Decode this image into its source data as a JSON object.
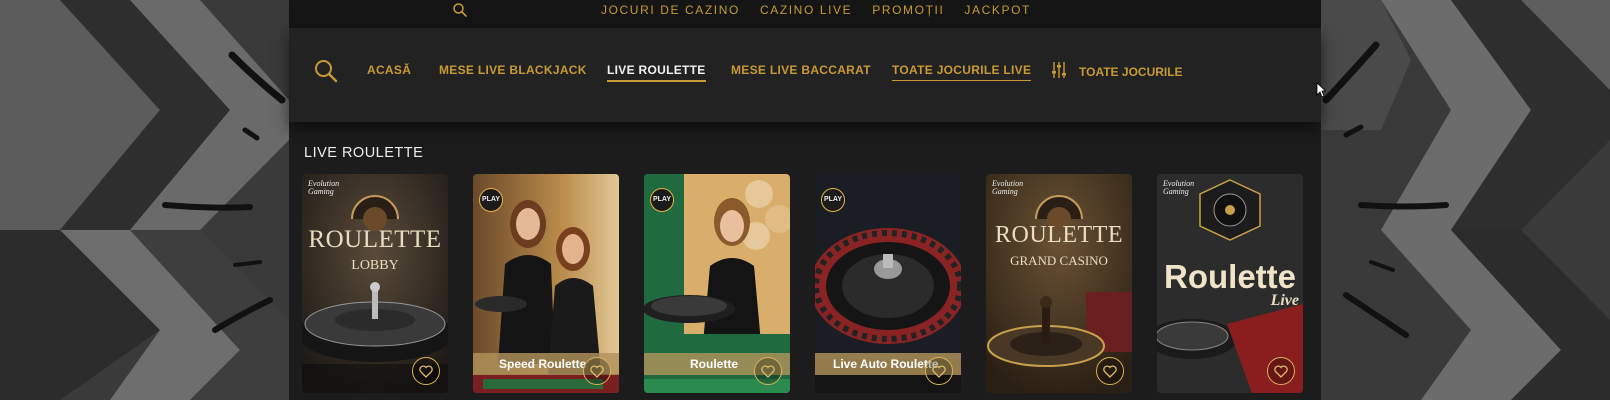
{
  "top_nav": {
    "links": [
      "JOCURI DE CAZINO",
      "CAZINO LIVE",
      "PROMOȚII",
      "JACKPOT"
    ]
  },
  "category_nav": {
    "tabs": [
      {
        "label": "ACASĂ",
        "state": "normal"
      },
      {
        "label": "MESE LIVE BLACKJACK",
        "state": "normal"
      },
      {
        "label": "LIVE ROULETTE",
        "state": "active"
      },
      {
        "label": "MESE LIVE BACCARAT",
        "state": "normal"
      },
      {
        "label": "TOATE JOCURILE LIVE",
        "state": "hover"
      }
    ],
    "filter_label": "TOATE JOCURILE"
  },
  "section": {
    "title": "LIVE ROULETTE"
  },
  "games": [
    {
      "provider": "Evolution Gaming",
      "art_title": "ROULETTE",
      "art_subtitle": "LOBBY",
      "name": "",
      "icon": "heart-icon"
    },
    {
      "provider": "PLAY",
      "art_title": "",
      "art_subtitle": "",
      "name": "Speed Roulette",
      "icon": "heart-icon"
    },
    {
      "provider": "PLAY",
      "art_title": "",
      "art_subtitle": "",
      "name": "Roulette",
      "icon": "heart-icon"
    },
    {
      "provider": "PLAY",
      "art_title": "",
      "art_subtitle": "",
      "name": "Live Auto Roulette",
      "icon": "heart-icon"
    },
    {
      "provider": "Evolution Gaming",
      "art_title": "ROULETTE",
      "art_subtitle": "GRAND CASINO",
      "name": "",
      "icon": "heart-icon"
    },
    {
      "provider": "Evolution Gaming",
      "art_title": "Roulette",
      "art_subtitle": "Live",
      "name": "",
      "icon": "heart-icon"
    }
  ],
  "colors": {
    "accent_gold": "#c79a36",
    "background": "#1c1c1c",
    "side_pattern": "#3c3c3c"
  }
}
